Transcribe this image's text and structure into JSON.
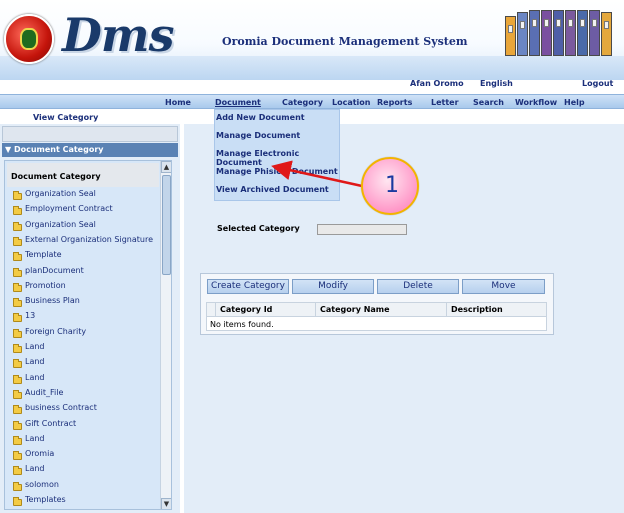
{
  "header": {
    "logo_text": "Dms",
    "title": "Oromia Document Management System",
    "lang_links": [
      "Afan Oromo",
      "English"
    ],
    "logout": "Logout"
  },
  "nav": {
    "items": [
      "Home",
      "Document",
      "Category",
      "Location",
      "Reports",
      "Letter",
      "Search",
      "Workflow",
      "Help"
    ],
    "active": "Document"
  },
  "subnav": {
    "view_category": "View Category"
  },
  "document_menu": {
    "items": [
      "Add New Document",
      "Manage Document",
      "Manage Electronic Document",
      "Manage Phisical Document",
      "View Archived Document"
    ]
  },
  "left_panel": {
    "header": "▼ Document Category",
    "tree_title": "Document Category",
    "items": [
      "Organization Seal",
      "Employment Contract",
      "Organization Seal",
      "External Organization Signature",
      "Template",
      "planDocument",
      "Promotion",
      "Business Plan",
      "13",
      "Foreign Charity",
      "Land",
      "Land",
      "Land",
      "Audit_File",
      "business Contract",
      "Gift Contract",
      "Land",
      "Oromia",
      "Land",
      "solomon",
      "Templates"
    ]
  },
  "selected_category": {
    "label": "Selected Category",
    "value": ""
  },
  "category_actions": {
    "buttons": [
      "Create Category",
      "Modify",
      "Delete",
      "Move"
    ],
    "columns": [
      "Category Id",
      "Category Name",
      "Description"
    ],
    "empty_message": "No items found."
  },
  "annotation": {
    "number": "1"
  },
  "icons": {
    "folder": "folder-icon",
    "scroll_up": "scroll-up-icon",
    "scroll_down": "scroll-down-icon"
  }
}
